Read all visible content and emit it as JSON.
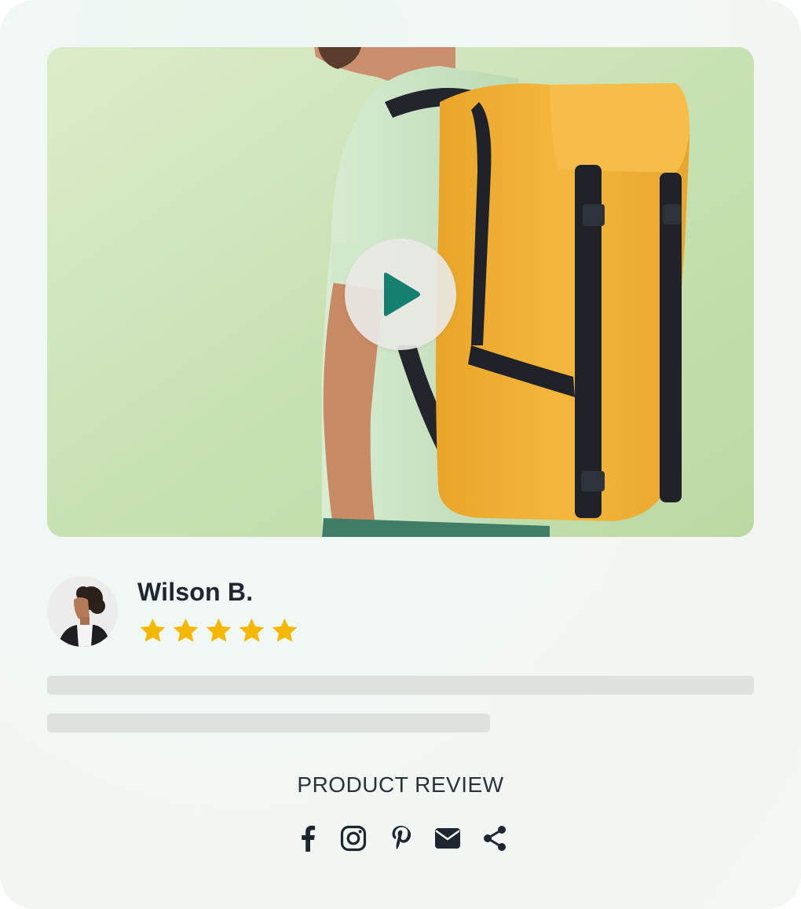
{
  "review": {
    "reviewer_name": "Wilson B.",
    "rating": 5,
    "rating_max": 5,
    "section_label": "PRODUCT REVIEW"
  },
  "media": {
    "type": "video",
    "play_icon": "play-icon"
  },
  "share": [
    {
      "icon": "facebook-icon"
    },
    {
      "icon": "instagram-icon"
    },
    {
      "icon": "pinterest-icon"
    },
    {
      "icon": "email-icon"
    },
    {
      "icon": "share-icon"
    }
  ],
  "colors": {
    "star": "#f5b800",
    "play": "#157f70",
    "text": "#1f2630",
    "skeleton": "#dde2df",
    "backpack": "#f2b134"
  }
}
